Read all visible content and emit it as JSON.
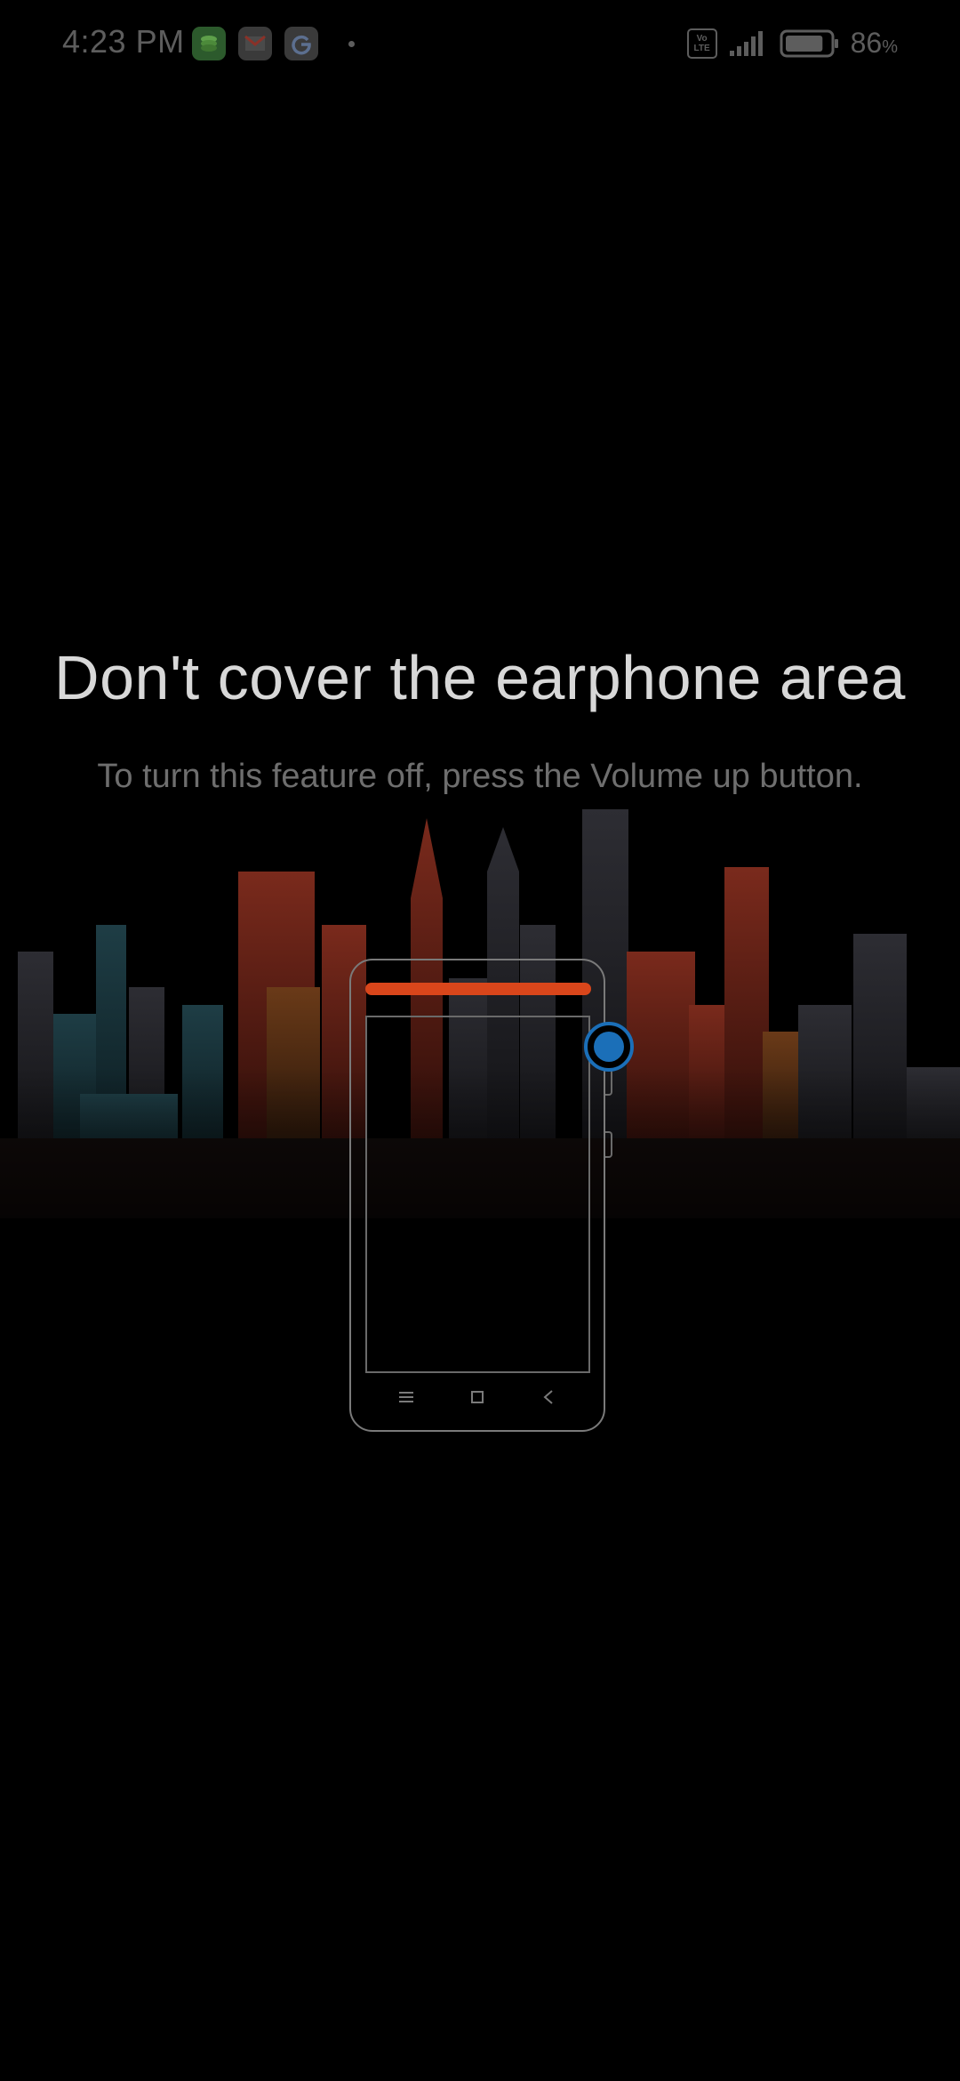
{
  "status_bar": {
    "time": "4:23 PM",
    "volte": "Vo LTE",
    "battery_percent": "86",
    "battery_unit": "%",
    "battery_level": 0.86,
    "notifications": [
      "stack-app-icon",
      "gmail-icon",
      "google-icon",
      "more-dot-icon"
    ]
  },
  "main": {
    "title": "Don't cover the earphone area",
    "subtitle": "To turn this feature off, press the Volume up button."
  },
  "illustration": {
    "earphone_color": "#d9461b",
    "sensor_color": "#1b6fb8",
    "nav_icons": [
      "menu-icon",
      "home-icon",
      "back-icon"
    ]
  },
  "colors": {
    "background": "#000000",
    "title": "#d8d8d8",
    "subtitle": "#6e6e6e"
  }
}
